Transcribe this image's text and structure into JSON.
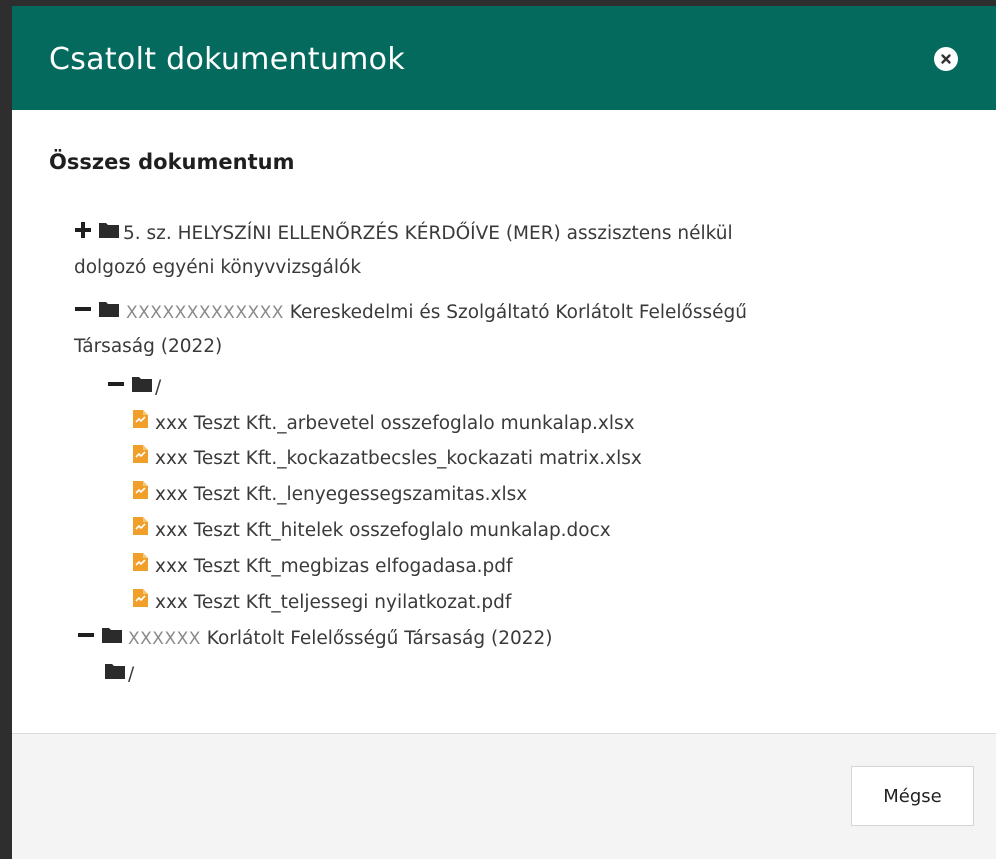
{
  "modal": {
    "title": "Csatolt dokumentumok",
    "close_icon": "close-icon",
    "section_title": "Összes dokumentum",
    "colors": {
      "header": "#046a5e",
      "file_icon": "#f0a02a",
      "folder_icon": "#2b2b2b"
    }
  },
  "tree": {
    "node1": {
      "toggle": "+",
      "label_line1": "5. sz. HELYSZÍNI ELLENŐRZÉS KÉRDŐÍVE (MER) asszisztens nélkül",
      "label_line2": "dolgozó egyéni könyvvizsgálók"
    },
    "node2": {
      "toggle": "−",
      "mask": "XXXXXXXXXXXXX",
      "label_line1": " Kereskedelmi és Szolgáltató Korlátolt Felelősségű",
      "label_line2": "Társaság (2022)",
      "subfolder": "/",
      "subfolder_toggle": "−",
      "files": [
        "xxx Teszt Kft._arbevetel osszefoglalo munkalap.xlsx",
        "xxx Teszt Kft._kockazatbecsles_kockazati matrix.xlsx",
        "xxx Teszt Kft._lenyegessegszamitas.xlsx",
        "xxx Teszt Kft_hitelek osszefoglalo munkalap.docx",
        "xxx Teszt Kft_megbizas elfogadasa.pdf",
        "xxx Teszt Kft_teljessegi nyilatkozat.pdf"
      ]
    },
    "node3": {
      "toggle": "−",
      "mask": "XXXXXX",
      "label": " Korlátolt Felelősségű Társaság (2022)",
      "subfolder": "/"
    }
  },
  "footer": {
    "cancel_label": "Mégse"
  }
}
